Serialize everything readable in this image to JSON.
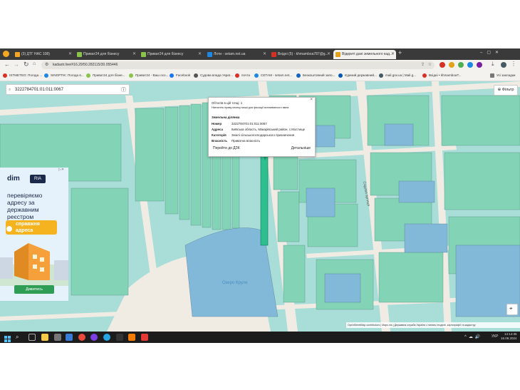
{
  "browser": {
    "tabs": [
      {
        "label": "(3) ДТГ НАС 108)",
        "color": "#f5a623"
      },
      {
        "label": "Приват24 для бізнесу",
        "color": "#8bc34a"
      },
      {
        "label": "Приват24 для бізнесу",
        "color": "#8bc34a"
      },
      {
        "label": "Лоти - setam.net.ua",
        "color": "#1e88e5"
      },
      {
        "label": "Вхідні (5) - khmamboa787@g...",
        "color": "#d93025"
      },
      {
        "label": "Відкриті дані земельного кад...",
        "color": "#e4a11b"
      }
    ],
    "new_tab": "+",
    "url": "kadastr.live/#16.29/50.282115/30.055446",
    "bookmarks": [
      {
        "label": "ISTMETEO: Погода ...",
        "color": "#d93025"
      },
      {
        "label": "SINOPTIK: Погода в...",
        "color": "#1e88e5"
      },
      {
        "label": "Приват24 для бізне...",
        "color": "#8bc34a"
      },
      {
        "label": "Приват24 - Ваш осо...",
        "color": "#8bc34a"
      },
      {
        "label": "Facebook",
        "color": "#1877f2"
      },
      {
        "label": "Судова влада Украї...",
        "color": "#555555"
      },
      {
        "label": "почта",
        "color": "#d93025"
      },
      {
        "label": "СЕТАМ - setam.net...",
        "color": "#1e88e5"
      },
      {
        "label": "Безкоштовний запо...",
        "color": "#1565c0"
      },
      {
        "label": "Єдиний державний...",
        "color": "#0057b7"
      },
      {
        "label": "mail.gov.ua | Mail.g...",
        "color": "#455a64"
      },
      {
        "label": "Вхідні • khmamboaT...",
        "color": "#d93025"
      }
    ],
    "all_bookmarks": "Усі закладки"
  },
  "map": {
    "search_value": "3222784701:01:011:0067",
    "filter_label": "Фільтр",
    "lake_label": "Озеро Круле",
    "street_label_1": "Садова вулиця",
    "attribution": "OpenStreetMap contributors | Maps.ms | Державна служба України з питань геодезії, картографії та кадастру"
  },
  "popup": {
    "objects_line": "Об'єктів в цій точці: 1",
    "hint": "Натисніть праву кнопку миші для фіксації вспливаючого вікна",
    "section_title": "Земельна ділянка",
    "rows": [
      {
        "key": "Номер",
        "value": "3222784701:01:011:0067"
      },
      {
        "key": "Адреса",
        "value": "Київська область, Макарівський район, с.Мостище"
      },
      {
        "key": "Категорія",
        "value": "Землі сільськогосподарського призначення"
      },
      {
        "key": "Власність",
        "value": "Приватна власність"
      }
    ],
    "link_dzk": "Перейти до ДЗК",
    "link_details": "Детальніше",
    "close": "×"
  },
  "ad": {
    "brand": "dim",
    "brand2": "RIA",
    "headline": "перевіряємо адресу за державним реєстром",
    "tag": "справжня адреса",
    "cta": "Дивитись"
  },
  "taskbar": {
    "time": "14:14:35",
    "date": "16.09.2024",
    "lang": "УКР"
  }
}
